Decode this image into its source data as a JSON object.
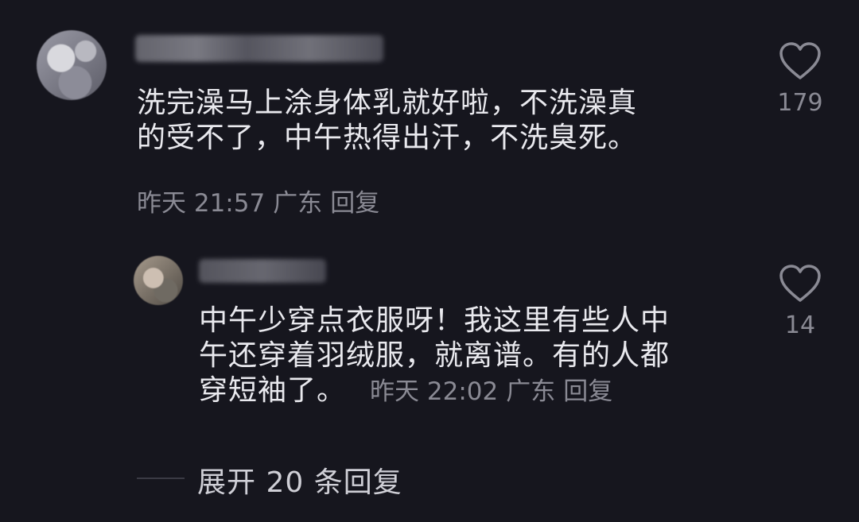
{
  "comment": {
    "text_line1": "洗完澡马上涂身体乳就好啦，不洗澡真",
    "text_line2": "的受不了，中午热得出汗，不洗臭死。",
    "time": "昨天 21:57",
    "location": "广东",
    "reply_label": "回复",
    "like_count": "179"
  },
  "reply": {
    "text_line1": "中午少穿点衣服呀！我这里有些人中",
    "text_line2": "午还穿着羽绒服，就离谱。有的人都",
    "text_line3": "穿短袖了。",
    "time": "昨天 22:02",
    "location": "广东",
    "reply_label": "回复",
    "like_count": "14"
  },
  "expand": {
    "label": "展开 20 条回复"
  },
  "colors": {
    "background": "#16161e",
    "text": "#e9e9ee",
    "meta": "#8a8a94"
  }
}
